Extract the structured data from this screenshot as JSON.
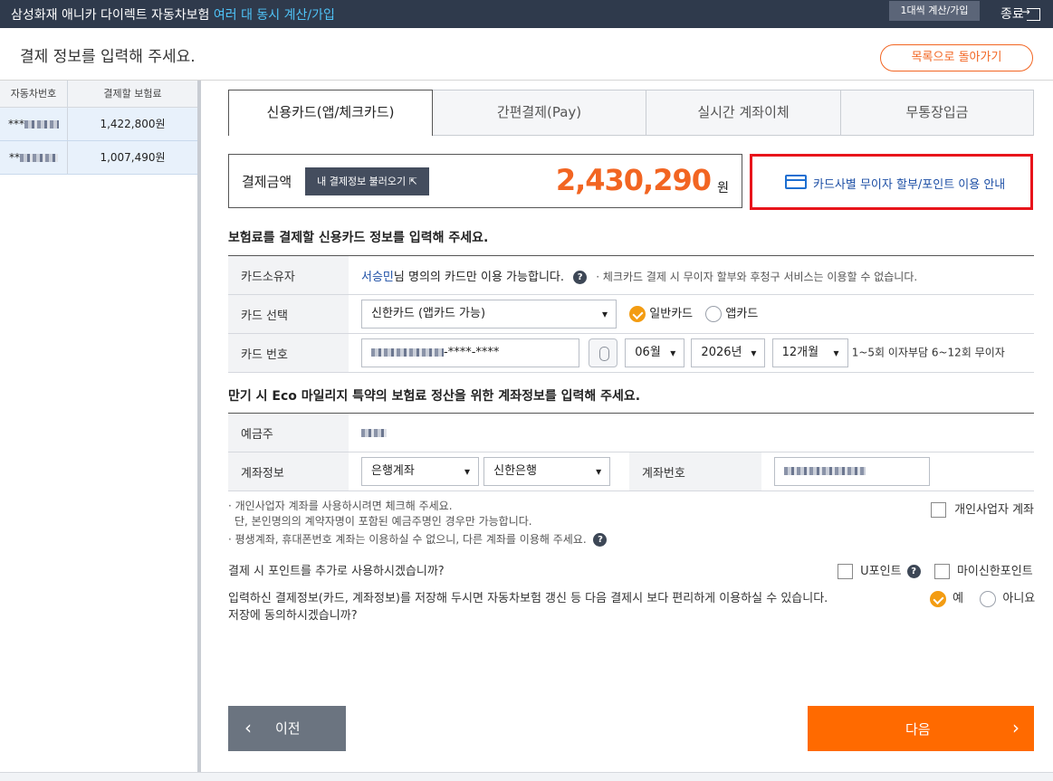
{
  "topbar": {
    "title_main": "삼성화재 애니카 다이렉트 자동차보험",
    "title_highlight": "여러 대 동시 계산/가입",
    "multi_button": "1대씩 계산/가입",
    "exit_label": "종료"
  },
  "header": {
    "title": "결제 정보를 입력해 주세요.",
    "back_button": "목록으로 돌아가기"
  },
  "left_table": {
    "headers": [
      "자동차번호",
      "결제할 보험료"
    ],
    "rows": [
      {
        "car_prefix": "***",
        "premium": "1,422,800원"
      },
      {
        "car_prefix": "**",
        "premium": "1,007,490원"
      }
    ]
  },
  "tabs": [
    "신용카드(앱/체크카드)",
    "간편결제(Pay)",
    "실시간 계좌이체",
    "무통장입금"
  ],
  "payment": {
    "label": "결제금액",
    "load_button": "내 결제정보 불러오기",
    "amount": "2,430,290",
    "unit": "원"
  },
  "guide": {
    "text": "카드사별 무이자 할부/포인트 이용 안내"
  },
  "card_section": {
    "title": "보험료를 결제할 신용카드 정보를 입력해 주세요.",
    "owner_label": "카드소유자",
    "owner_name": "서승민",
    "owner_text": "님 명의의 카드만 이용 가능합니다.",
    "owner_note": "· 체크카드 결제 시 무이자 할부와 후청구 서비스는 이용할 수 없습니다.",
    "select_label": "카드 선택",
    "card_company": "신한카드 (앱카드 가능)",
    "radio_normal": "일반카드",
    "radio_app": "앱카드",
    "number_label": "카드 번호",
    "number_masked": "-****-****",
    "month": "06월",
    "year": "2026년",
    "installment": "12개월",
    "installment_note": "1~5회 이자부담 6~12회 무이자"
  },
  "account_section": {
    "title": "만기 시 Eco 마일리지 특약의 보험료 정산을 위한 계좌정보를 입력해 주세요.",
    "holder_label": "예금주",
    "info_label": "계좌정보",
    "account_type": "은행계좌",
    "bank": "신한은행",
    "number_label": "계좌번호"
  },
  "notes": {
    "biz_line1": "· 개인사업자 계좌를 사용하시려면 체크해 주세요.",
    "biz_line2": "단, 본인명의의 계약자명이 포함된 예금주명인 경우만 가능합니다.",
    "biz_check": "개인사업자 계좌",
    "restrict": "· 평생계좌, 휴대폰번호 계좌는 이용하실 수 없으니, 다른 계좌를 이용해 주세요."
  },
  "points": {
    "question": "결제 시 포인트를 추가로 사용하시겠습니까?",
    "upoint": "U포인트",
    "mypoint": "마이신한포인트"
  },
  "save_consent": {
    "line1": "입력하신 결제정보(카드, 계좌정보)를 저장해 두시면 자동차보험 갱신 등 다음 결제시 보다 편리하게 이용하실 수 있습니다.",
    "line2": "저장에 동의하시겠습니까?",
    "yes": "예",
    "no": "아니요"
  },
  "nav": {
    "prev": "이전",
    "next": "다음"
  },
  "colors": {
    "accent": "#f26522",
    "next_button": "#ff6a00",
    "highlight_box": "#e8141b"
  }
}
